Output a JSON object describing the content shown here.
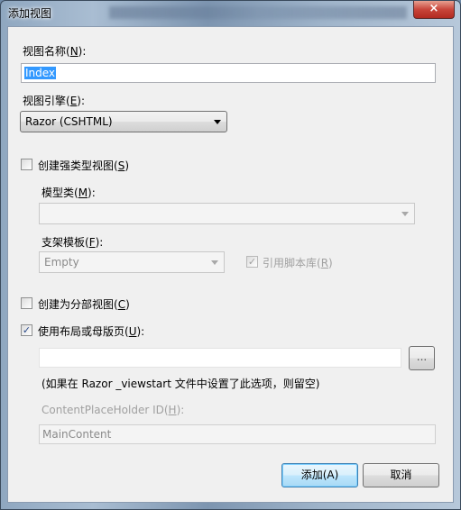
{
  "window": {
    "title": "添加视图",
    "close_icon": "×"
  },
  "view_name": {
    "label": "视图名称(",
    "key": "N",
    "after": "):",
    "value": "Index"
  },
  "view_engine": {
    "label": "视图引擎(",
    "key": "E",
    "after": "):",
    "value": "Razor (CSHTML)"
  },
  "strongly_typed": {
    "label": "创建强类型视图(",
    "key": "S",
    "after": ")",
    "checked": false
  },
  "model_class": {
    "label": "模型类(",
    "key": "M",
    "after": "):",
    "value": ""
  },
  "scaffold_template": {
    "label": "支架模板(",
    "key": "F",
    "after": "):",
    "value": "Empty"
  },
  "reference_scripts": {
    "label": "引用脚本库(",
    "key": "R",
    "after": ")",
    "checked": true,
    "check_mark": "✓"
  },
  "partial_view": {
    "label": "创建为分部视图(",
    "key": "C",
    "after": ")",
    "checked": false
  },
  "use_layout": {
    "label": "使用布局或母版页(",
    "key": "U",
    "after": "):",
    "checked": true,
    "check_mark": "✓",
    "value": "",
    "browse_label": "..."
  },
  "hint": "(如果在 Razor _viewstart 文件中设置了此选项，则留空)",
  "content_placeholder": {
    "label": "ContentPlaceHolder ID(",
    "key": "H",
    "after": "):",
    "value": "MainContent"
  },
  "buttons": {
    "add": "添加(A)",
    "cancel": "取消"
  }
}
